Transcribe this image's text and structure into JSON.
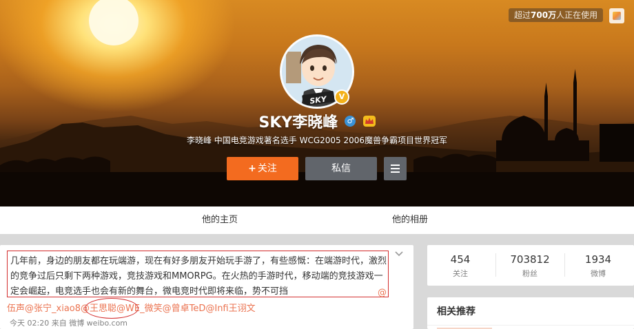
{
  "cover": {
    "usage_badge_prefix": "超过",
    "usage_badge_count": "700万",
    "usage_badge_suffix": "人正在使用",
    "avatar_text": "SKY",
    "verified_badge": "V"
  },
  "profile": {
    "name": "SKY李晓峰",
    "gender_icon": "male-icon",
    "gender_glyph": "♂",
    "level_icon": "vip-icon",
    "bio": "李晓峰 中国电竞游戏著名选手 WCG2005 2006魔兽争霸项目世界冠军"
  },
  "actions": {
    "follow_plus": "+",
    "follow_label": "关注",
    "message_label": "私信"
  },
  "tabs": [
    {
      "label": "他的主页"
    },
    {
      "label": "他的相册"
    }
  ],
  "post": {
    "text": "几年前，身边的朋友都在玩端游，现在有好多朋友开始玩手游了，有些感慨：在端游时代，激烈的竞争过后只剩下两种游戏，竞技游戏和MMORPG。在火热的手游时代，移动端的竞技游戏一定会崛起，电竞选手也会有新的舞台，微电竞时代即将来临，势不可挡",
    "tail_at": "@",
    "mentions": [
      "伍声",
      "@张宁_xiao8",
      "@王思聪",
      "@WE_微笑",
      "@曾卓TeD",
      "@Infi王诩文"
    ],
    "meta": "今天 02:20 来自 微博 weibo.com"
  },
  "stats": [
    {
      "value": "454",
      "label": "关注"
    },
    {
      "value": "703812",
      "label": "粉丝"
    },
    {
      "value": "1934",
      "label": "微博"
    }
  ],
  "recommend": {
    "title": "相关推荐"
  },
  "colors": {
    "accent": "#f36b1f",
    "link": "#eb7350",
    "annotation": "#d32c2c",
    "button_gray": "#61656b"
  }
}
